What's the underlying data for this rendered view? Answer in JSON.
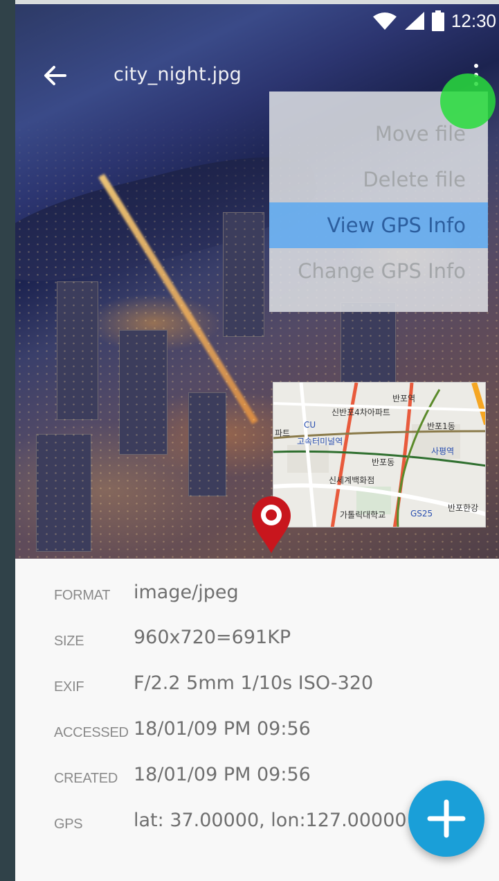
{
  "status_bar": {
    "time": "12:30"
  },
  "toolbar": {
    "title": "city_night.jpg"
  },
  "menu": {
    "items": [
      {
        "label": "Move file"
      },
      {
        "label": "Delete file"
      },
      {
        "label": "View GPS Info",
        "selected": true
      },
      {
        "label": "Change GPS Info"
      }
    ]
  },
  "map": {
    "labels": [
      "반포역",
      "신반포4차아파트",
      "CU",
      "반포1동",
      "고속터미널역",
      "사평역",
      "반포동",
      "신세계백화점",
      "가톨릭대학교",
      "GS25",
      "반포한강",
      "파트"
    ]
  },
  "info": {
    "rows": [
      {
        "key": "FORMAT",
        "value": "image/jpeg"
      },
      {
        "key": "SIZE",
        "value": "960x720=691KP"
      },
      {
        "key": "EXIF",
        "value": "F/2.2 5mm 1/10s ISO-320"
      },
      {
        "key": "ACCESSED",
        "value": "18/01/09 PM 09:56"
      },
      {
        "key": "CREATED",
        "value": "18/01/09 PM 09:56"
      },
      {
        "key": "GPS",
        "value": "lat: 37.00000, lon:127.00000"
      }
    ]
  },
  "colors": {
    "accent": "#1a9fd8",
    "menu_highlight": "#5ca8f0",
    "pin": "#c8161d"
  },
  "icons": {
    "back": "arrow-left-icon",
    "overflow": "more-vert-icon",
    "fab": "plus-icon",
    "pin": "map-pin-icon"
  }
}
